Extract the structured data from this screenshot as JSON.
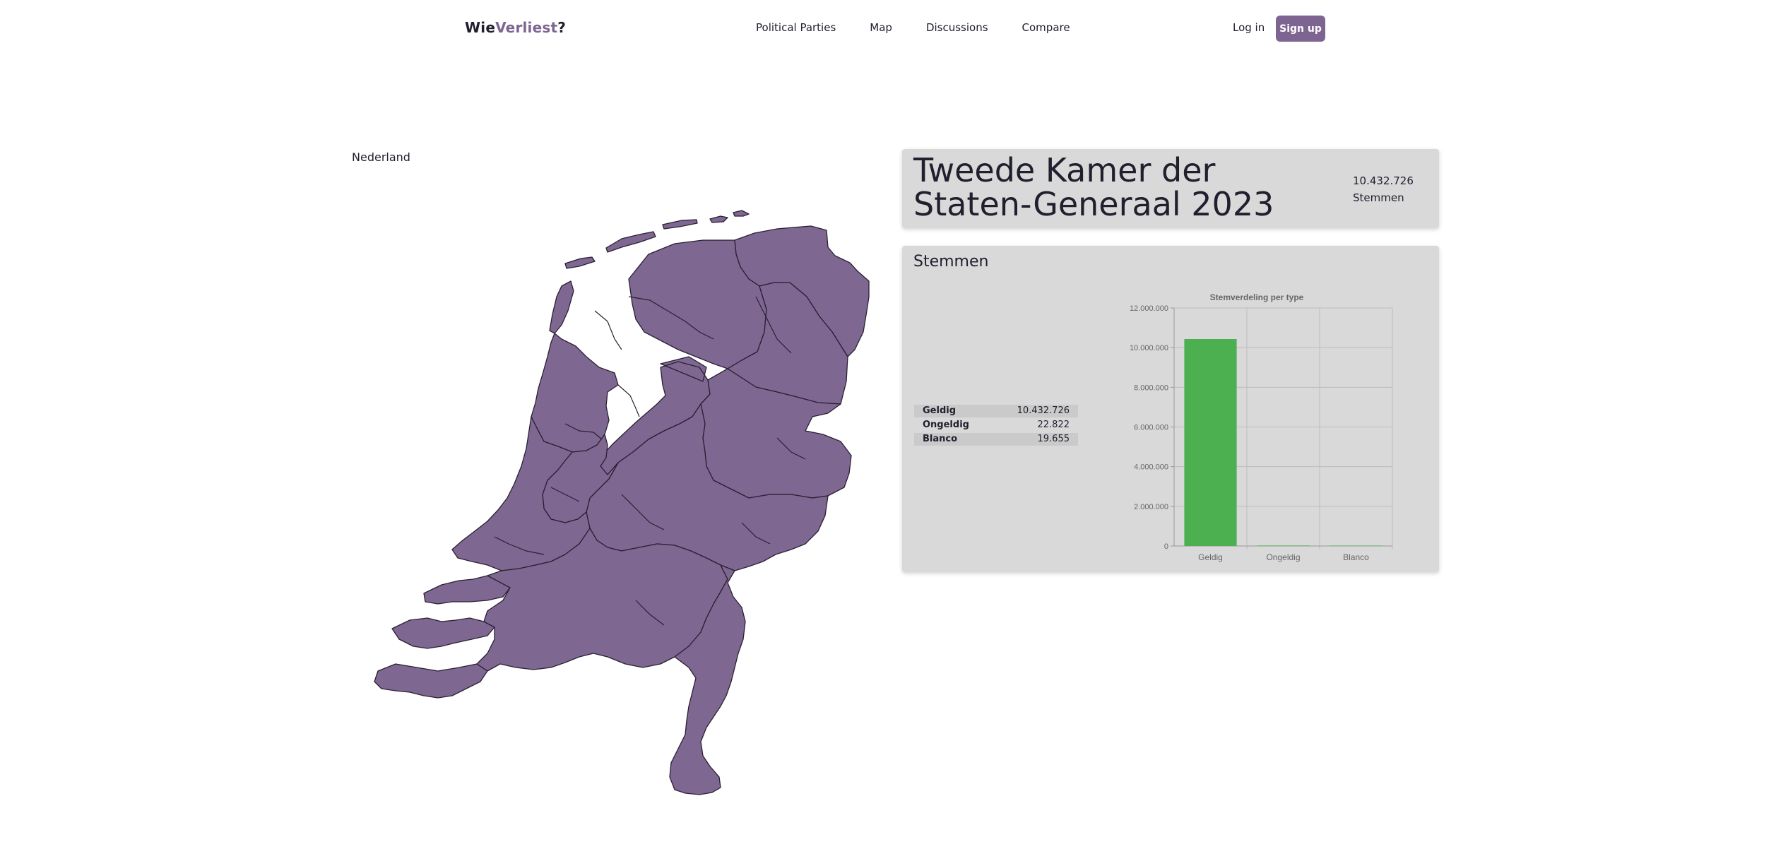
{
  "nav": {
    "logo_part1": "Wie",
    "logo_part2": "Verliest",
    "logo_part3": "?",
    "links": [
      "Political Parties",
      "Map",
      "Discussions",
      "Compare"
    ],
    "login": "Log in",
    "signup": "Sign up"
  },
  "map": {
    "region_label": "Nederland",
    "fill_color": "#7e6791"
  },
  "election": {
    "title": "Tweede Kamer der Staten-Generaal 2023",
    "total_votes": "10.432.726",
    "total_label": "Stemmen"
  },
  "votes": {
    "heading": "Stemmen",
    "rows": [
      {
        "label": "Geldig",
        "value": "10.432.726"
      },
      {
        "label": "Ongeldig",
        "value": "22.822"
      },
      {
        "label": "Blanco",
        "value": "19.655"
      }
    ]
  },
  "chart_data": {
    "type": "bar",
    "title": "Stemverdeling per type",
    "categories": [
      "Geldig",
      "Ongeldig",
      "Blanco"
    ],
    "values": [
      10432726,
      22822,
      19655
    ],
    "ylim": [
      0,
      12000000
    ],
    "yticks": [
      0,
      2000000,
      4000000,
      6000000,
      8000000,
      10000000,
      12000000
    ],
    "ytick_labels": [
      "0",
      "2.000.000",
      "4.000.000",
      "6.000.000",
      "8.000.000",
      "10.000.000",
      "12.000.000"
    ],
    "bar_color": "#4caf50",
    "grid": true,
    "xlabel": "",
    "ylabel": ""
  }
}
